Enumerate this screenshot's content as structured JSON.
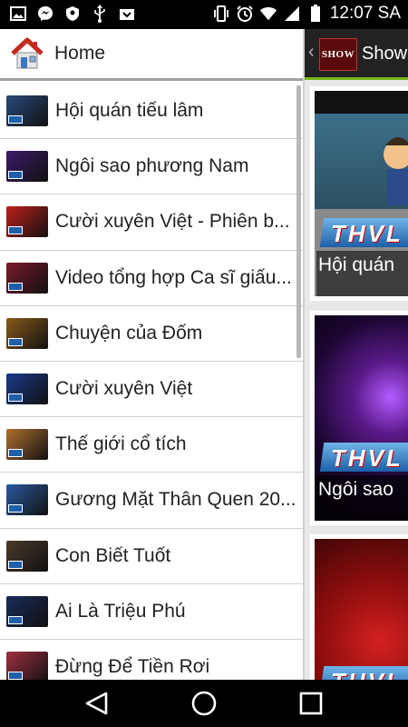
{
  "status_bar": {
    "time": "12:07 SA",
    "left_icons": [
      "image-icon",
      "messenger-icon",
      "shield-icon",
      "usb-icon",
      "download-icon"
    ],
    "right_icons": [
      "vibrate-icon",
      "alarm-icon",
      "wifi-icon",
      "signal-icon",
      "battery-icon"
    ]
  },
  "action_bar": {
    "logo_text": "SHOW",
    "title": "Show"
  },
  "drawer": {
    "home_label": "Home",
    "items": [
      {
        "label": "Hội quán tiếu lâm",
        "thumb_color": "#2a4a7a"
      },
      {
        "label": "Ngôi sao phương Nam",
        "thumb_color": "#3a1a6a"
      },
      {
        "label": "Cười xuyên Việt - Phiên b...",
        "thumb_color": "#c0201a"
      },
      {
        "label": "Video tổng hợp Ca sĩ giấu...",
        "thumb_color": "#7a1a2a"
      },
      {
        "label": "Chuyện của Đốm",
        "thumb_color": "#8a5a1a"
      },
      {
        "label": "Cười xuyên Việt",
        "thumb_color": "#1a3a8a"
      },
      {
        "label": "Thế giới cổ tích",
        "thumb_color": "#b07030"
      },
      {
        "label": "Gương Mặt Thân Quen 20...",
        "thumb_color": "#2a5aa0"
      },
      {
        "label": "Con Biết Tuốt",
        "thumb_color": "#4a3a2a"
      },
      {
        "label": "Ai Là Triệu Phú",
        "thumb_color": "#1a2a5a"
      },
      {
        "label": "Đừng Để Tiền Rơi",
        "thumb_color": "#a03040"
      }
    ]
  },
  "cards": [
    {
      "caption": "Hội quán",
      "logo": "THVL"
    },
    {
      "caption": "Ngôi sao",
      "logo": "THVL"
    },
    {
      "caption": "",
      "logo": "THVL"
    }
  ],
  "colors": {
    "accent_green": "#7ab51d",
    "action_bar": "#222222",
    "drawer_bg": "#ffffff"
  }
}
